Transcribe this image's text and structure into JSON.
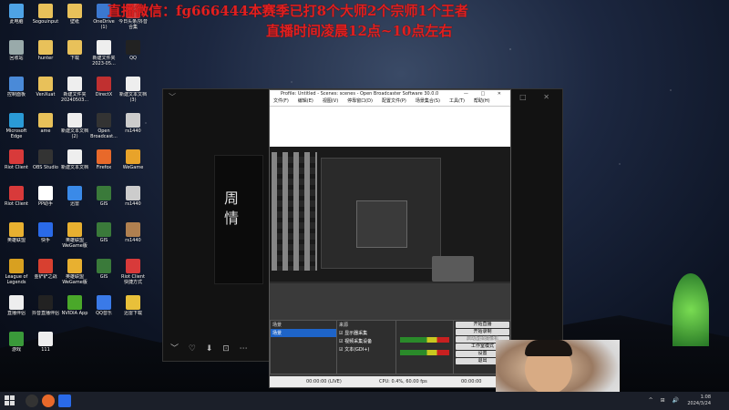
{
  "overlay": {
    "line1": "直播微信：fg666444本赛季已打8个大师2个宗师1个王者",
    "line2": "直播时间凌晨12点~10点左右"
  },
  "desktop_icons": [
    {
      "label": "此电脑",
      "color": "#4ea3e6"
    },
    {
      "label": "Sogouinput",
      "color": "#e8c15a"
    },
    {
      "label": "壁纸",
      "color": "#e8c15a"
    },
    {
      "label": "OneDrive (1)",
      "color": "#3b78d0"
    },
    {
      "label": "今日头条/抖音合集",
      "color": "#d94040"
    },
    {
      "label": "回收站",
      "color": "#9aa"
    },
    {
      "label": "hunter",
      "color": "#e8c15a"
    },
    {
      "label": "下载",
      "color": "#e8c15a"
    },
    {
      "label": "新建文件夹 2023-05...",
      "color": "#eee"
    },
    {
      "label": "QQ",
      "color": "#222"
    },
    {
      "label": "控制面板",
      "color": "#4a8ad8"
    },
    {
      "label": "VenXuat",
      "color": "#e8c15a"
    },
    {
      "label": "新建文件夹 20240503...",
      "color": "#eee"
    },
    {
      "label": "DirectX",
      "color": "#c03030"
    },
    {
      "label": "新建文本文档 (3)",
      "color": "#eee"
    },
    {
      "label": "Microsoft Edge",
      "color": "#2a9ad6"
    },
    {
      "label": "ame",
      "color": "#e8c15a"
    },
    {
      "label": "新建文本文档 (2)",
      "color": "#eee"
    },
    {
      "label": "Open Broadcast...",
      "color": "#333"
    },
    {
      "label": "rs1440",
      "color": "#ccc"
    },
    {
      "label": "Riot Client",
      "color": "#d83a3a"
    },
    {
      "label": "OBS Studio",
      "color": "#333"
    },
    {
      "label": "新建文本文档",
      "color": "#eee"
    },
    {
      "label": "Firefox",
      "color": "#e8692a"
    },
    {
      "label": "WeGame",
      "color": "#e8a32a"
    },
    {
      "label": "Riot Client",
      "color": "#d83a3a"
    },
    {
      "label": "PP助手",
      "color": "#fff"
    },
    {
      "label": "迅雷",
      "color": "#3a8ae8"
    },
    {
      "label": "GIS",
      "color": "#3a7a3a"
    },
    {
      "label": "rs1440",
      "color": "#ccc"
    },
    {
      "label": "英雄联盟",
      "color": "#e8b030"
    },
    {
      "label": "快手",
      "color": "#2a6ae8"
    },
    {
      "label": "英雄联盟 WeGame版",
      "color": "#e8b030"
    },
    {
      "label": "GIS",
      "color": "#3a7a3a"
    },
    {
      "label": "rs1440",
      "color": "#b08050"
    },
    {
      "label": "League of Legends",
      "color": "#d8a020"
    },
    {
      "label": "金铲铲之战",
      "color": "#d84030"
    },
    {
      "label": "英雄联盟 WeGame版",
      "color": "#e8b030"
    },
    {
      "label": "GIS",
      "color": "#3a7a3a"
    },
    {
      "label": "Riot Client 快捷方式",
      "color": "#d83a3a"
    },
    {
      "label": "直播伴侣",
      "color": "#eee"
    },
    {
      "label": "抖音直播伴侣",
      "color": "#222"
    },
    {
      "label": "NVIDIA App",
      "color": "#4aa82a"
    },
    {
      "label": "QQ音乐",
      "color": "#3a7ae8"
    },
    {
      "label": "迅雷下载",
      "color": "#e8c03a"
    },
    {
      "label": "游戏",
      "color": "#3a9a3a"
    },
    {
      "label": "111",
      "color": "#eee"
    }
  ],
  "obs": {
    "title": "Profile: Untitled - Scenes: scenes - Open Broadcaster Software 30.0.0",
    "menu": [
      "文件(F)",
      "编辑(E)",
      "视图(V)",
      "停靠窗口(D)",
      "配置文件(P)",
      "场景集合(S)",
      "工具(T)",
      "帮助(H)"
    ],
    "scenes_header": "场景",
    "scenes": [
      "场景"
    ],
    "sources_header": "来源",
    "sources": [
      "显示器采集",
      "视频采集设备",
      "文本(GDI+)"
    ],
    "controls": [
      "开始直播",
      "开始录制",
      "启动虚拟摄像机",
      "工作室模式",
      "设置",
      "退出"
    ],
    "control_top": "控制",
    "status_left": "00:00:00 (LIVE)",
    "status_mid": "CPU: 0.4%, 60.00 fps",
    "status_right": "00:00:00"
  },
  "player": {
    "album_text": "周\n情"
  },
  "taskbar": {
    "time": "1:08",
    "date": "2024/3/24"
  }
}
